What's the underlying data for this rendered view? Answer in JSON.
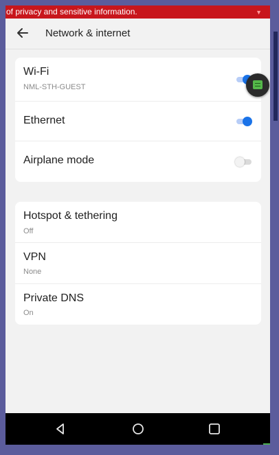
{
  "banner": {
    "text": "of privacy and sensitive information."
  },
  "header": {
    "title": "Network & internet"
  },
  "sections": [
    {
      "rows": [
        {
          "title": "Wi-Fi",
          "subtitle": "NML-STH-GUEST",
          "toggle_on": true
        },
        {
          "title": "Ethernet",
          "toggle_on": true
        },
        {
          "title": "Airplane mode",
          "toggle_on": false
        }
      ]
    },
    {
      "rows": [
        {
          "title": "Hotspot & tethering",
          "subtitle": "Off"
        },
        {
          "title": "VPN",
          "subtitle": "None"
        },
        {
          "title": "Private DNS",
          "subtitle": "On"
        }
      ]
    }
  ],
  "icons": {
    "back": "arrow-left-icon",
    "floating": "floating-app-icon",
    "nav_back": "triangle-back-icon",
    "nav_home": "circle-home-icon",
    "nav_recents": "square-recents-icon"
  },
  "colors": {
    "banner": "#c8161c",
    "accent": "#1a73e8",
    "toggle_track_on": "#b7cdf7",
    "background": "#f2f2f2",
    "card": "#ffffff",
    "navbar": "#000000"
  }
}
